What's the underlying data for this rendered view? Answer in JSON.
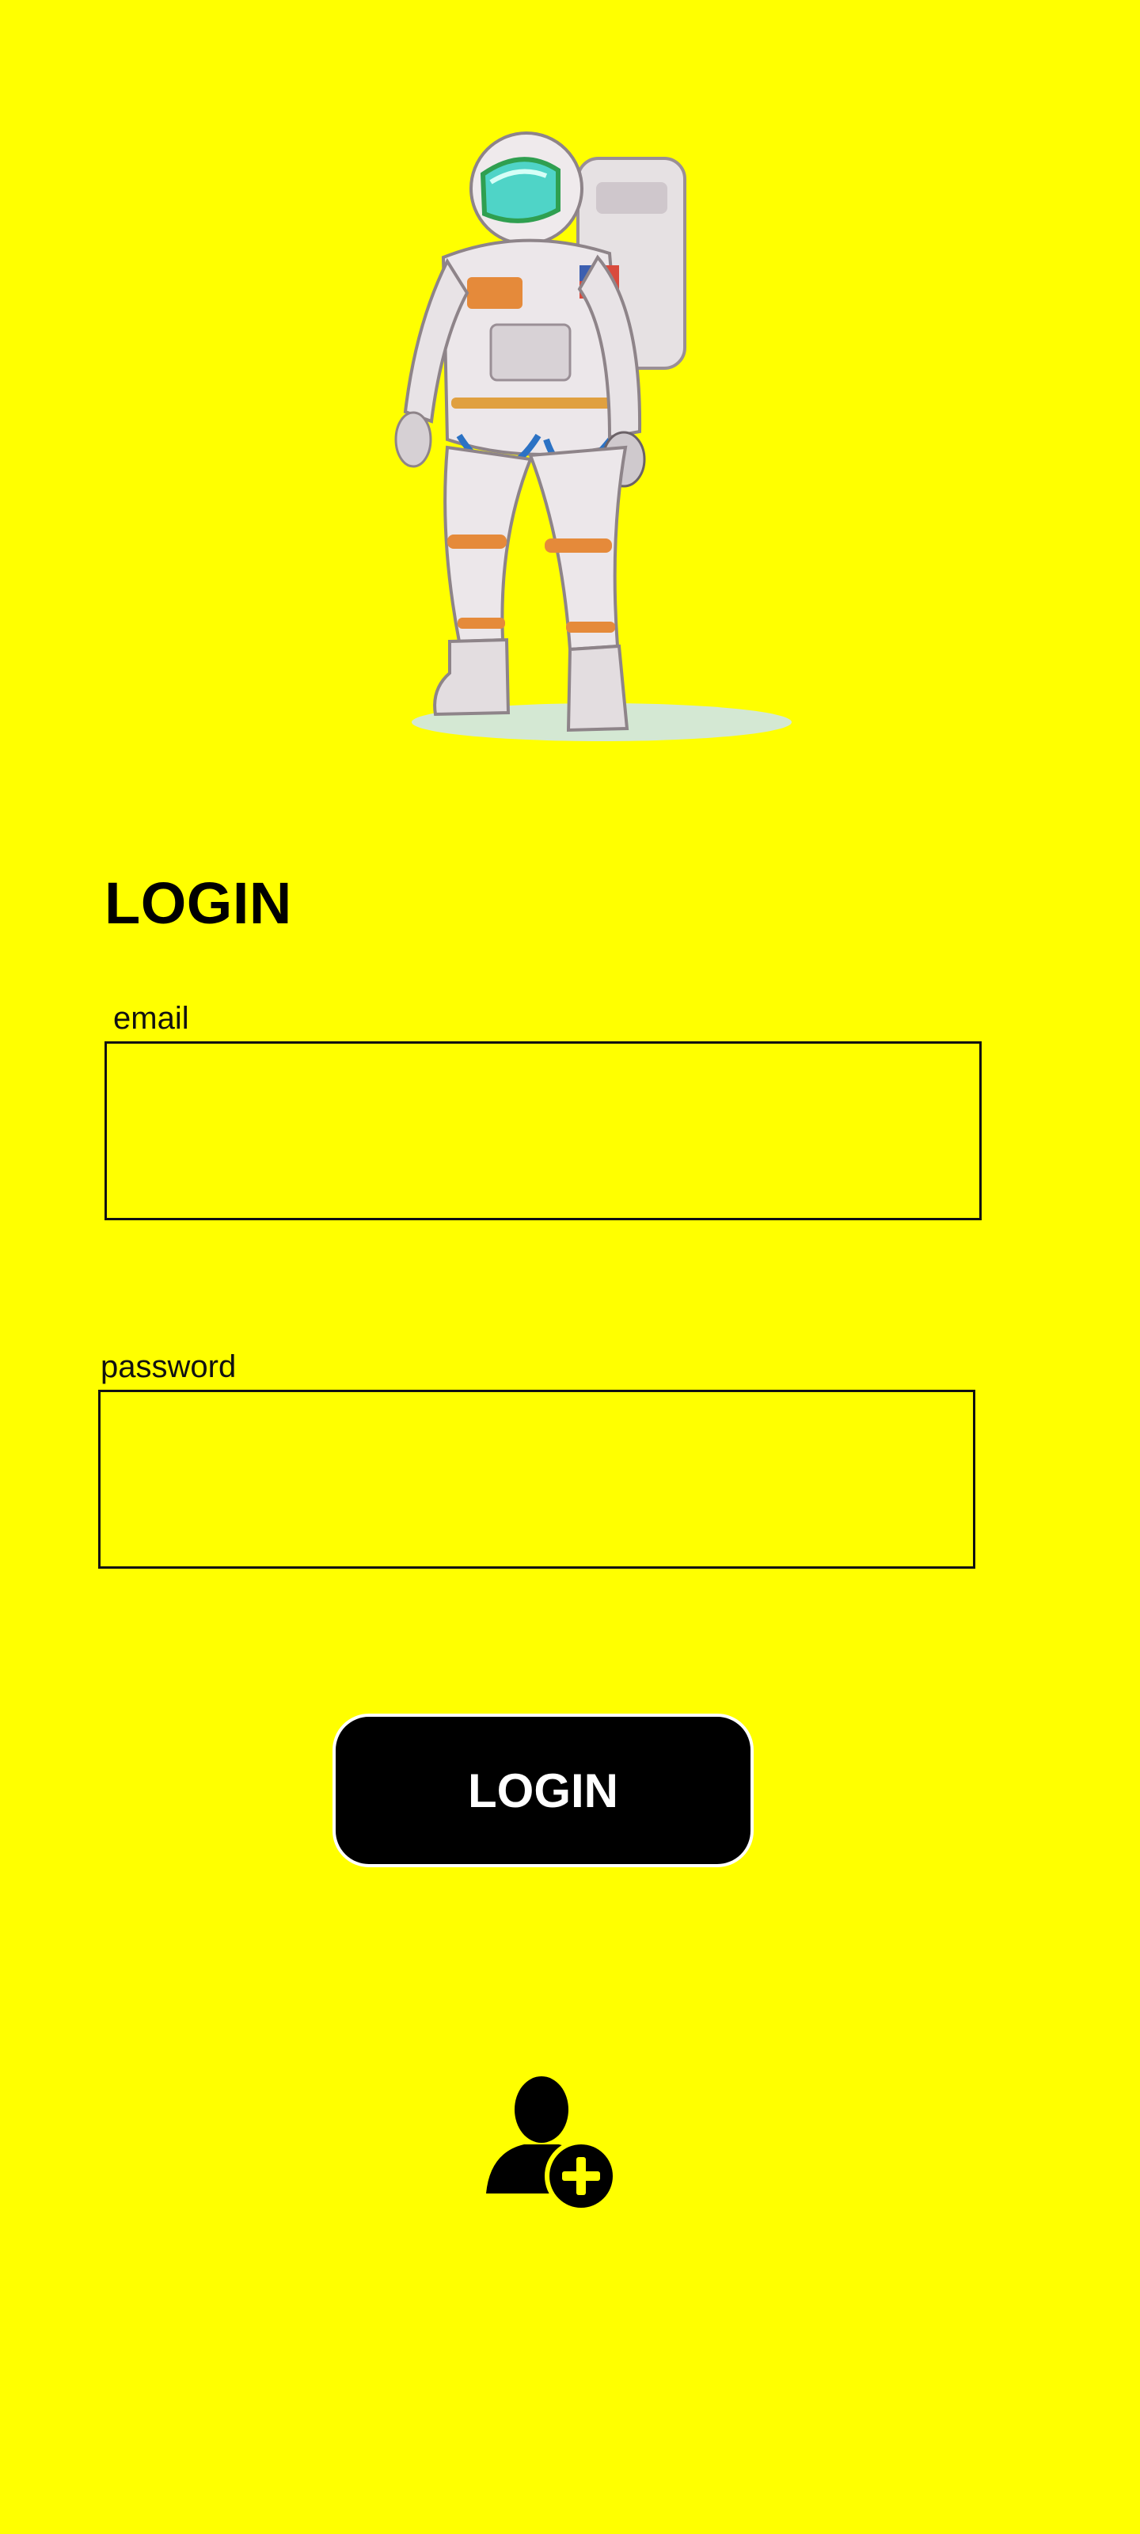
{
  "login_form": {
    "title": "LOGIN",
    "email_label": "email",
    "email_value": "",
    "password_label": "password",
    "password_value": "",
    "submit_label": "LOGIN"
  },
  "icons": {
    "hero": "astronaut-illustration",
    "register": "add-user-icon"
  },
  "colors": {
    "background": "#FFFF00",
    "text": "#000000",
    "button_bg": "#000000",
    "button_text": "#FFFFFF"
  }
}
